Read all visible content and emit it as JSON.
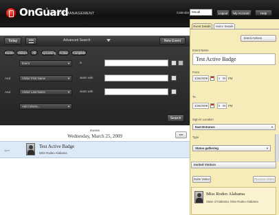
{
  "header": {
    "logo": "OnGuard",
    "logo_reg": "®",
    "subtitle": "VISITOR MANAGEMENT",
    "calendar_label": "Calendar",
    "calendar_value": "Moudl",
    "buttons": {
      "logout": "Logout",
      "my_account": "My Account",
      "help": "Help"
    }
  },
  "toolbar": {
    "today": "Today",
    "advanced_search": "Advanced Search",
    "new_event": "New Event"
  },
  "filters": {
    "chips": [
      "Events",
      "Visitors",
      "All",
      "Upcoming",
      "Active",
      "Complete"
    ],
    "rows": [
      {
        "conjunction": "",
        "field": "Event",
        "operator": "is",
        "value": ""
      },
      {
        "conjunction": "And",
        "field": "Visitor First Name",
        "operator": "starts with",
        "value": ""
      },
      {
        "conjunction": "And",
        "field": "Visitor Last Name",
        "operator": "starts with",
        "value": ""
      }
    ],
    "add_criteria": "Add Criteria...",
    "search_button": "Search"
  },
  "results": {
    "header": "Events",
    "date": "Wednesday, March 25, 2009",
    "nav": "◂ ▸",
    "items": [
      {
        "time": "1pm",
        "title": "Test Active Badge",
        "subtitle": "Miss Rodeo Alabama"
      }
    ]
  },
  "right_panel": {
    "tabs": [
      "Event Details",
      "Visitor Details"
    ],
    "actions": "Event Actions",
    "event_name_label": "Event Name",
    "event_name": "Test Active Badge",
    "from_label": "From",
    "from_date": "3/25/2009",
    "from_time": "4 : 00",
    "from_ampm": "PM",
    "to_label": "To",
    "to_date": "3/25/2009",
    "to_time": "5 : 00",
    "to_ampm": "PM",
    "location_label": "Sign-in Location",
    "location_value": "East Entrance",
    "type_label": "Type",
    "type_value": "Status gathering",
    "invited_label": "Invited Visitors",
    "invite_button": "Invite Visitor",
    "remove_button": "Remove Visitor",
    "visitor_name": "Miss Rodeo Alabama",
    "visitor_detail": "State of Alabama, Miss Rodeo Alabama"
  }
}
